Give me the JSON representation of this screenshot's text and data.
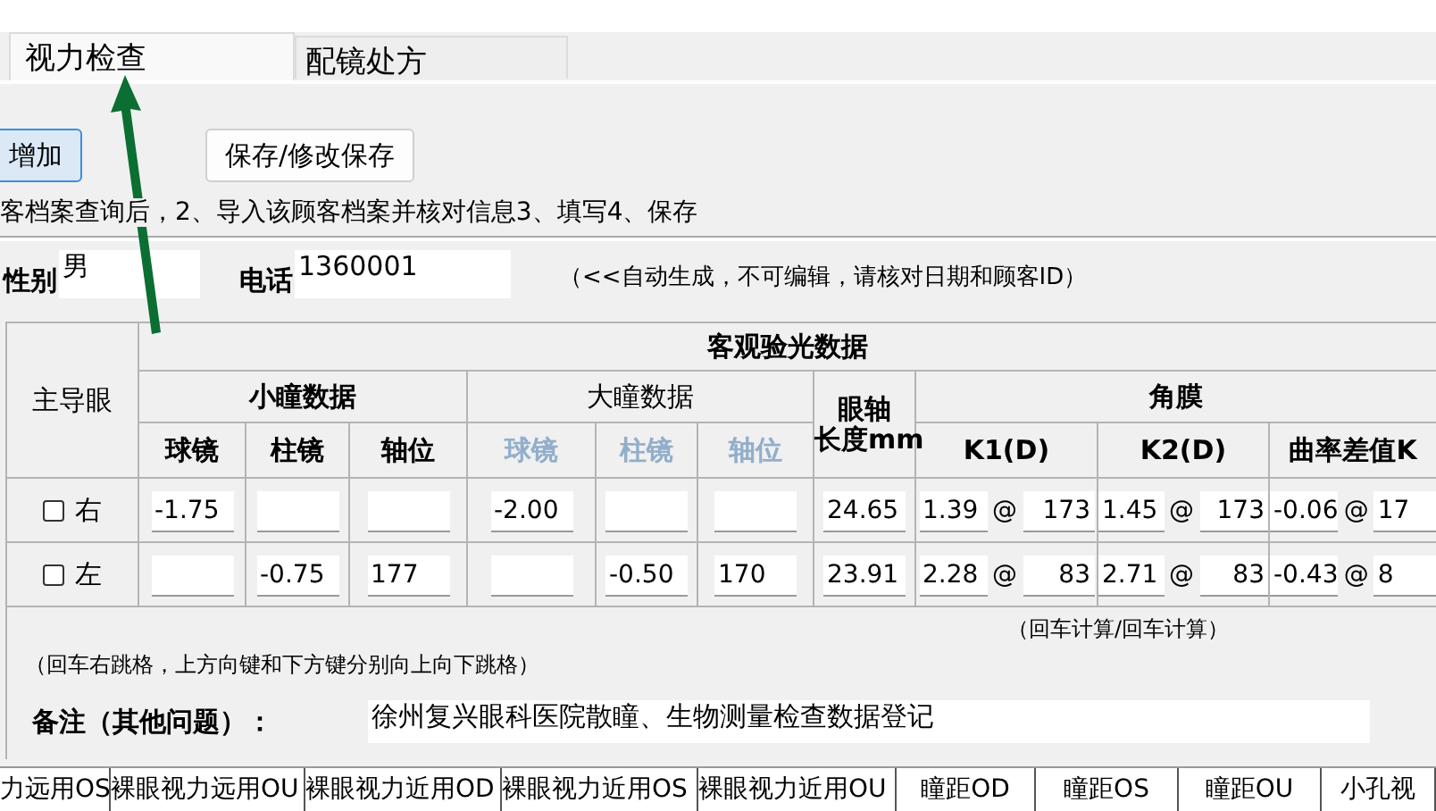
{
  "tabs": [
    {
      "label": "视力检查",
      "selected": true
    },
    {
      "label": "配镜处方",
      "selected": false
    }
  ],
  "toolbar": [
    {
      "label": "增加",
      "kind": "primary"
    },
    {
      "label": "保存/修改保存",
      "kind": "plain"
    }
  ],
  "instruction": "客档案查询后，2、导入该顾客档案并核对信息3、填写4、保存",
  "fields": [
    {
      "label": "性别",
      "value": "男"
    },
    {
      "label": "电话",
      "value": "1360001"
    }
  ],
  "fields_note": "（<<自动生成，不可编辑，请核对日期和顾客ID）",
  "exam_table": {
    "title": "客观验光数据",
    "dominant_eye": "主导眼",
    "small_pupil": {
      "title": "小瞳数据",
      "disabled": false,
      "columns": [
        "球镜",
        "柱镜",
        "轴位"
      ]
    },
    "large_pupil": {
      "title": "大瞳数据",
      "disabled": true,
      "columns": [
        "球镜",
        "柱镜",
        "轴位"
      ]
    },
    "axial_length": [
      "眼轴",
      "长度mm"
    ],
    "cornea": {
      "title": "角膜",
      "columns": [
        "K1(D)",
        "K2(D)",
        "曲率差值K"
      ]
    },
    "rows": [
      {
        "eye": "右",
        "checked": false,
        "small": {
          "sphere": "-1.75"
        },
        "large": {
          "sphere": "-2.00"
        },
        "axial": "24.65",
        "k": [
          {
            "power": "1.39",
            "sep": "@",
            "axis": "173"
          },
          {
            "power": "1.45",
            "sep": "@",
            "axis": "173"
          },
          {
            "power": "-0.06",
            "sep": "@",
            "axis": "17"
          }
        ]
      },
      {
        "eye": "左",
        "checked": false,
        "small": {
          "cylinder": "-0.75",
          "axis": "177"
        },
        "large": {
          "cylinder": "-0.50",
          "axis": "170"
        },
        "axial": "23.91",
        "k": [
          {
            "power": "2.28",
            "sep": "@",
            "axis": "83"
          },
          {
            "power": "2.71",
            "sep": "@",
            "axis": "83"
          },
          {
            "power": "-0.43",
            "sep": "@",
            "axis": "8"
          }
        ]
      }
    ]
  },
  "calc_note": "（回车计算/回车计算）",
  "nav_note": "（回车右跳格，上方向键和下方键分别向上向下跳格）",
  "remark": {
    "label": "备注（其他问题）：",
    "value": "徐州复兴眼科医院散瞳、生物测量检查数据登记"
  },
  "bottom_columns": [
    "力远用OS",
    "裸眼视力远用OU",
    "裸眼视力近用OD",
    "裸眼视力近用OS",
    "裸眼视力近用OU",
    "瞳距OD",
    "瞳距OS",
    "瞳距OU",
    "小孔视"
  ]
}
